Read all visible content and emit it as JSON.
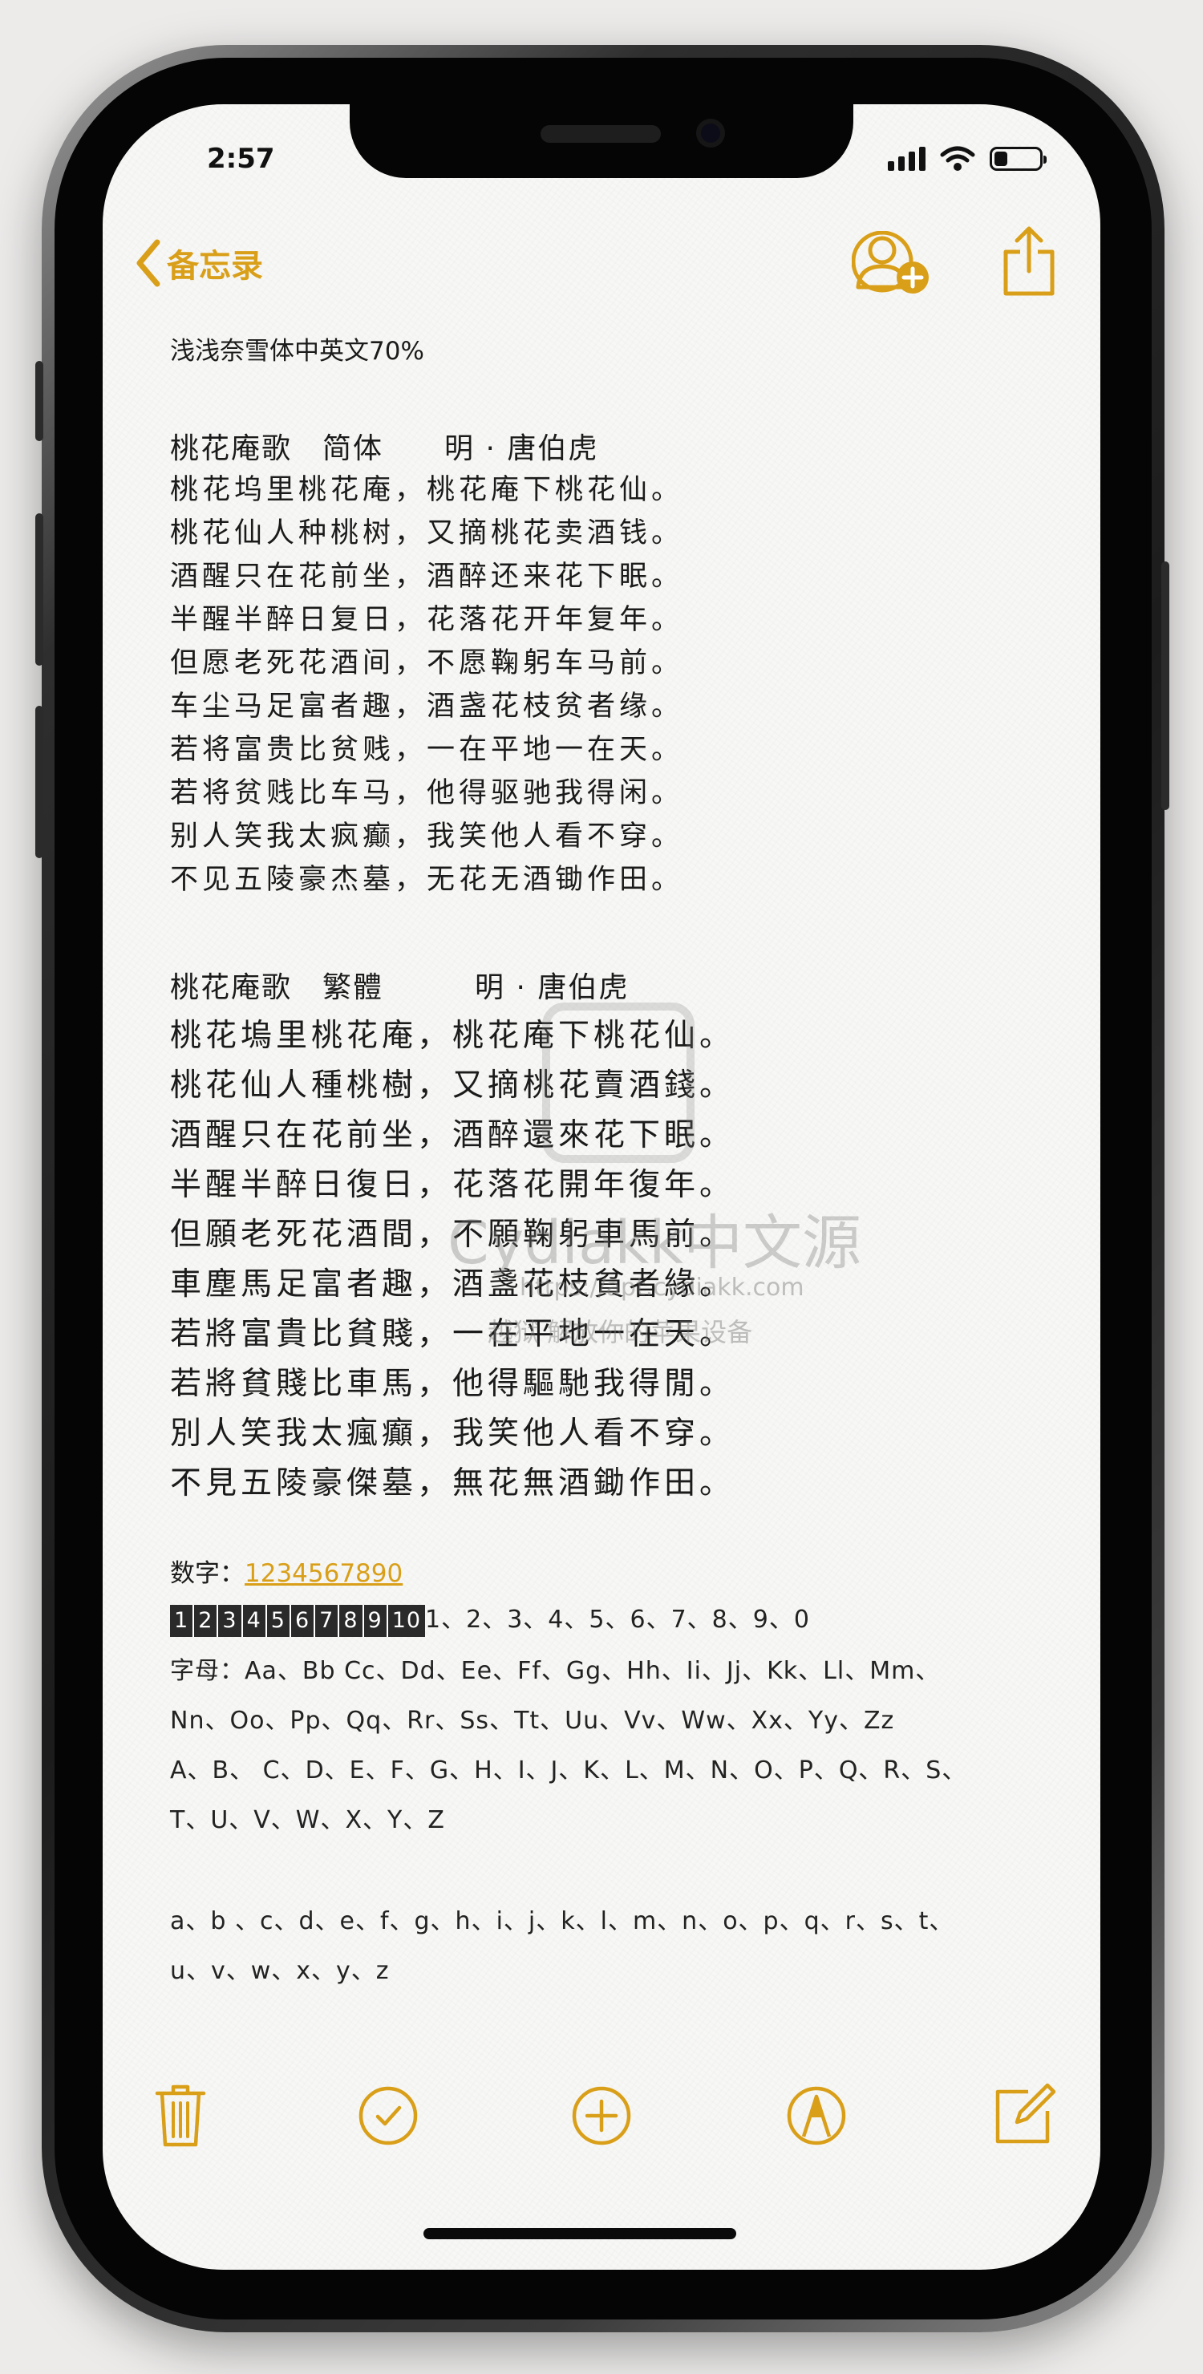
{
  "status": {
    "time": "2:57"
  },
  "nav": {
    "back_label": "备忘录"
  },
  "note": {
    "subtitle": "浅浅奈雪体中英文70%",
    "poem_simplified": {
      "title": "桃花庵歌　简体　　明 · 唐伯虎",
      "lines": [
        "桃花坞里桃花庵，桃花庵下桃花仙。",
        "桃花仙人种桃树，又摘桃花卖酒钱。",
        "酒醒只在花前坐，酒醉还来花下眠。",
        "半醒半醉日复日，花落花开年复年。",
        "但愿老死花酒间，不愿鞠躬车马前。",
        "车尘马足富者趣，酒盏花枝贫者缘。",
        "若将富贵比贫贱，一在平地一在天。",
        "若将贫贱比车马，他得驱驰我得闲。",
        "别人笑我太疯癫，我笑他人看不穿。",
        "不见五陵豪杰墓，无花无酒锄作田。"
      ]
    },
    "poem_traditional": {
      "title": "桃花庵歌　繁體　　　明 · 唐伯虎",
      "lines": [
        "桃花塢里桃花庵，桃花庵下桃花仙。",
        "桃花仙人種桃樹，又摘桃花賣酒錢。",
        "酒醒只在花前坐，酒醉還來花下眠。",
        "半醒半醉日復日，花落花開年復年。",
        "但願老死花酒間，不願鞠躬車馬前。",
        "車塵馬足富者趣，酒盞花枝貧者緣。",
        "若將富貴比貧賤，一在平地一在天。",
        "若將貧賤比車馬，他得驅馳我得閒。",
        "別人笑我太瘋癲，我笑他人看不穿。",
        "不見五陵豪傑墓，無花無酒鋤作田。"
      ]
    },
    "digits_label": "数字：",
    "digits_link": "1234567890",
    "boxed_digits": [
      "1",
      "2",
      "3",
      "4",
      "5",
      "6",
      "7",
      "8",
      "9",
      "10"
    ],
    "digits_list": "1、2、3、4、5、6、7、8、9、0",
    "letters_line1": "字母：Aa、Bb Cc、Dd、Ee、Ff、Gg、Hh、Ii、Jj、Kk、Ll、Mm、",
    "letters_line2": "Nn、Oo、Pp、Qq、Rr、Ss、Tt、Uu、Vv、Ww、Xx、Yy、Zz",
    "upper_line1": "A、B、 C、D、E、F、G、H、I、J、K、L、M、N、O、P、Q、R、S、",
    "upper_line2": "T、U、V、W、X、Y、Z",
    "lower_line1": "a、b 、c、d、e、f、g、h、i、j、k、l、m、n、o、p、q、r、s、t、",
    "lower_line2": "u、v、w、x、y、z"
  },
  "watermark": {
    "name": "Cydiakk中文源",
    "url": "https://apt.cydiakk.com",
    "slogan": "越狱 解放你的苹果设备"
  },
  "toolbar": {
    "icons": [
      "trash-icon",
      "checklist-icon",
      "add-icon",
      "markup-icon",
      "compose-icon"
    ]
  },
  "colors": {
    "accent": "#d99f19",
    "text": "#1b1b1b",
    "paper": "#f7f7f5"
  }
}
